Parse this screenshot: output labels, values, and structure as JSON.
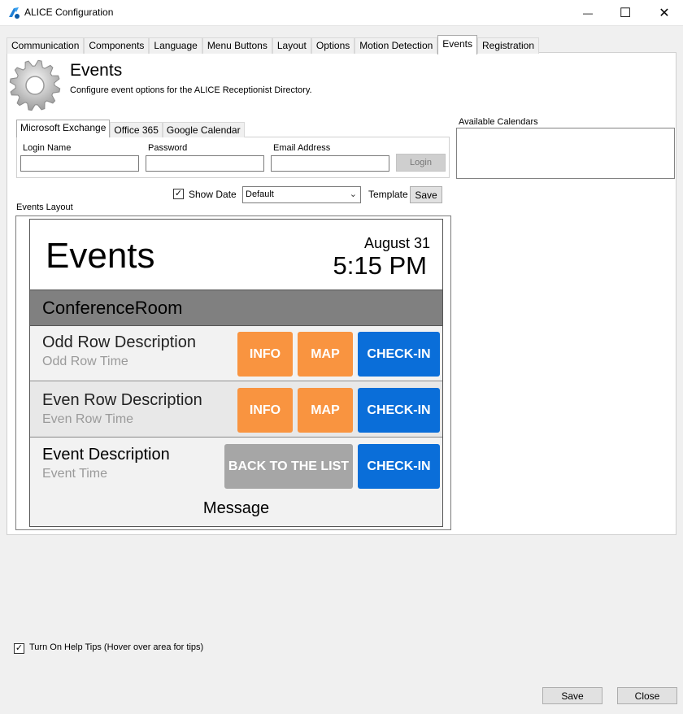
{
  "window": {
    "title": "ALICE Configuration",
    "minimize_glyph": "—",
    "maximize_glyph": "☐",
    "close_glyph": "✕"
  },
  "tabs": [
    {
      "label": "Communication"
    },
    {
      "label": "Components"
    },
    {
      "label": "Language"
    },
    {
      "label": "Menu Buttons"
    },
    {
      "label": "Layout"
    },
    {
      "label": "Options"
    },
    {
      "label": "Motion Detection"
    },
    {
      "label": "Events",
      "active": true
    },
    {
      "label": "Registration"
    }
  ],
  "header": {
    "title": "Events",
    "description": "Configure event options for the ALICE Receptionist Directory."
  },
  "calendar_tabs": [
    {
      "label": "Microsoft Exchange",
      "active": true
    },
    {
      "label": "Office 365"
    },
    {
      "label": "Google Calendar"
    }
  ],
  "exchange": {
    "login_name_label": "Login Name",
    "login_name_value": "",
    "password_label": "Password",
    "password_value": "",
    "email_label": "Email Address",
    "email_value": "",
    "login_button": "Login"
  },
  "available_calendars": {
    "label": "Available Calendars",
    "items": []
  },
  "template_row": {
    "show_date_label": "Show Date",
    "show_date_checked": true,
    "template_selected": "Default",
    "template_label": "Template",
    "save_button": "Save"
  },
  "events_layout": {
    "label": "Events Layout",
    "preview": {
      "title": "Events",
      "date": "August 31",
      "time": "5:15 PM",
      "room": "ConferenceRoom",
      "odd_row": {
        "description": "Odd Row Description",
        "time": "Odd Row Time"
      },
      "even_row": {
        "description": "Even Row Description",
        "time": "Even Row Time"
      },
      "event_row": {
        "description": "Event Description",
        "time": "Event Time"
      },
      "info_button": "INFO",
      "map_button": "MAP",
      "checkin_button": "CHECK-IN",
      "back_button": "BACK TO THE LIST",
      "message": "Message"
    }
  },
  "help_tips": {
    "label": "Turn On Help Tips (Hover over area for tips)",
    "checked": true
  },
  "footer": {
    "save_button": "Save",
    "close_button": "Close"
  },
  "colors": {
    "accent_orange": "#f99440",
    "accent_blue": "#0a6ed9",
    "disabled_gray": "#a6a6a6",
    "room_bar": "#808080"
  },
  "icons": {
    "app": "alice-app-icon",
    "header": "gear-icon",
    "checkmark": "✓",
    "dropdown": "⌄"
  }
}
